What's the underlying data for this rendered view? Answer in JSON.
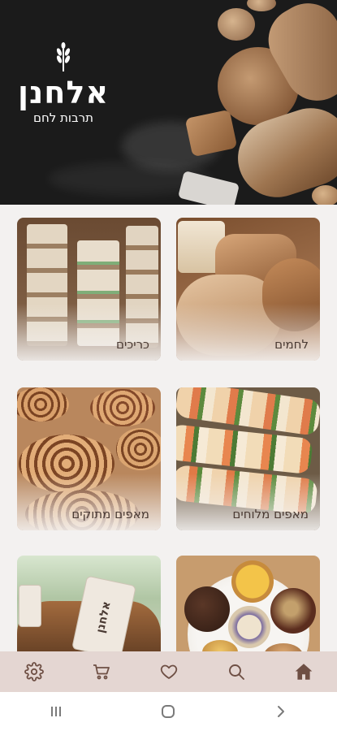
{
  "brand": {
    "name": "אלחנן",
    "tagline": "תרבות לחם"
  },
  "categories": [
    {
      "label": "כריכים"
    },
    {
      "label": "לחמים"
    },
    {
      "label": "מאפים מתוקים"
    },
    {
      "label": "מאפים מלוחים"
    },
    {
      "label": ""
    },
    {
      "label": ""
    }
  ],
  "package_tag": "אלחנן",
  "bottom_nav": [
    {
      "icon": "settings-icon"
    },
    {
      "icon": "cart-icon"
    },
    {
      "icon": "heart-icon"
    },
    {
      "icon": "search-icon"
    },
    {
      "icon": "home-icon"
    }
  ],
  "colors": {
    "nav_bg": "#e4d6d2",
    "icon": "#6e4f44",
    "accent": "#8a6a5e"
  }
}
